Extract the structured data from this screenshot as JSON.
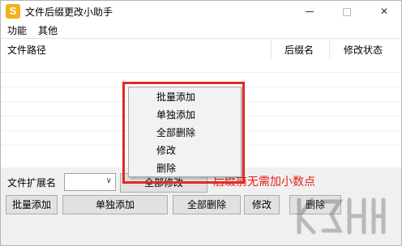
{
  "window": {
    "title": "文件后缀更改小助手",
    "icon_letter": "S",
    "controls": {
      "minimize": "minimize-icon",
      "maximize": "maximize-icon",
      "close": "✕"
    }
  },
  "menu": {
    "items": [
      "功能",
      "其他"
    ]
  },
  "table": {
    "columns": [
      "文件路径",
      "后缀名",
      "修改状态"
    ]
  },
  "context_menu": {
    "items": [
      "批量添加",
      "单独添加",
      "全部删除",
      "修改",
      "删除"
    ]
  },
  "bottom": {
    "ext_label": "文件扩展名",
    "ext_value": "",
    "modify_all": "全部修改",
    "hint": "后缀前无需加小数点",
    "buttons": [
      "批量添加",
      "单独添加",
      "全部删除",
      "修改",
      "删除"
    ]
  },
  "colors": {
    "highlight": "#e32a20",
    "hint": "#e0241a",
    "icon": "#f2b21a"
  }
}
